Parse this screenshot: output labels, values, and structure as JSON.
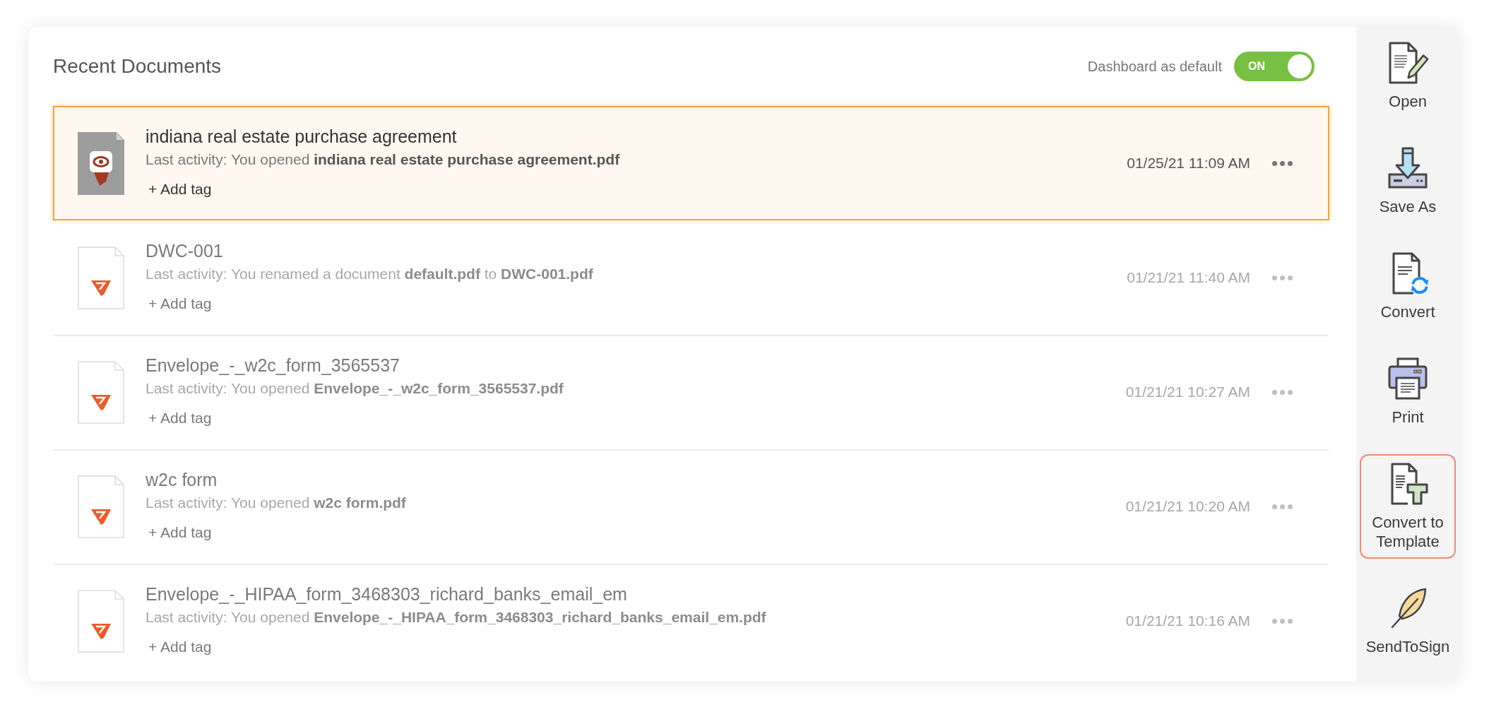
{
  "header": {
    "title": "Recent Documents",
    "default_toggle": {
      "label": "Dashboard as default",
      "state_text": "ON",
      "on": true
    }
  },
  "documents": [
    {
      "kind": "preview",
      "name": "indiana real estate purchase agreement",
      "activity": "Last activity: You opened **indiana real estate purchase agreement.pdf**",
      "add_tag": "+ Add tag",
      "date": "01/25/21 11:09 AM",
      "selected": true
    },
    {
      "kind": "file",
      "name": "DWC-001",
      "activity": "Last activity: You renamed a document **default.pdf** to **DWC-001.pdf**",
      "add_tag": "+ Add tag",
      "date": "01/21/21 11:40 AM",
      "selected": false
    },
    {
      "kind": "file",
      "name": "Envelope_-_w2c_form_3565537",
      "activity": "Last activity: You opened **Envelope_-_w2c_form_3565537.pdf**",
      "add_tag": "+ Add tag",
      "date": "01/21/21 10:27 AM",
      "selected": false
    },
    {
      "kind": "file",
      "name": "w2c form",
      "activity": "Last activity: You opened **w2c form.pdf**",
      "add_tag": "+ Add tag",
      "date": "01/21/21 10:20 AM",
      "selected": false
    },
    {
      "kind": "file",
      "name": "Envelope_-_HIPAA_form_3468303_richard_banks_email_em",
      "activity": "Last activity: You opened **Envelope_-_HIPAA_form_3468303_richard_banks_email_em.pdf**",
      "add_tag": "+ Add tag",
      "date": "01/21/21 10:16 AM",
      "selected": false
    }
  ],
  "tools": [
    {
      "kind": "open",
      "label": "Open",
      "selected": false
    },
    {
      "kind": "save",
      "label": "Save As",
      "selected": false
    },
    {
      "kind": "convert",
      "label": "Convert",
      "selected": false
    },
    {
      "kind": "print",
      "label": "Print",
      "selected": false
    },
    {
      "kind": "template",
      "label": "Convert to Template",
      "selected": true
    },
    {
      "kind": "sign",
      "label": "SendToSign",
      "selected": false
    }
  ]
}
